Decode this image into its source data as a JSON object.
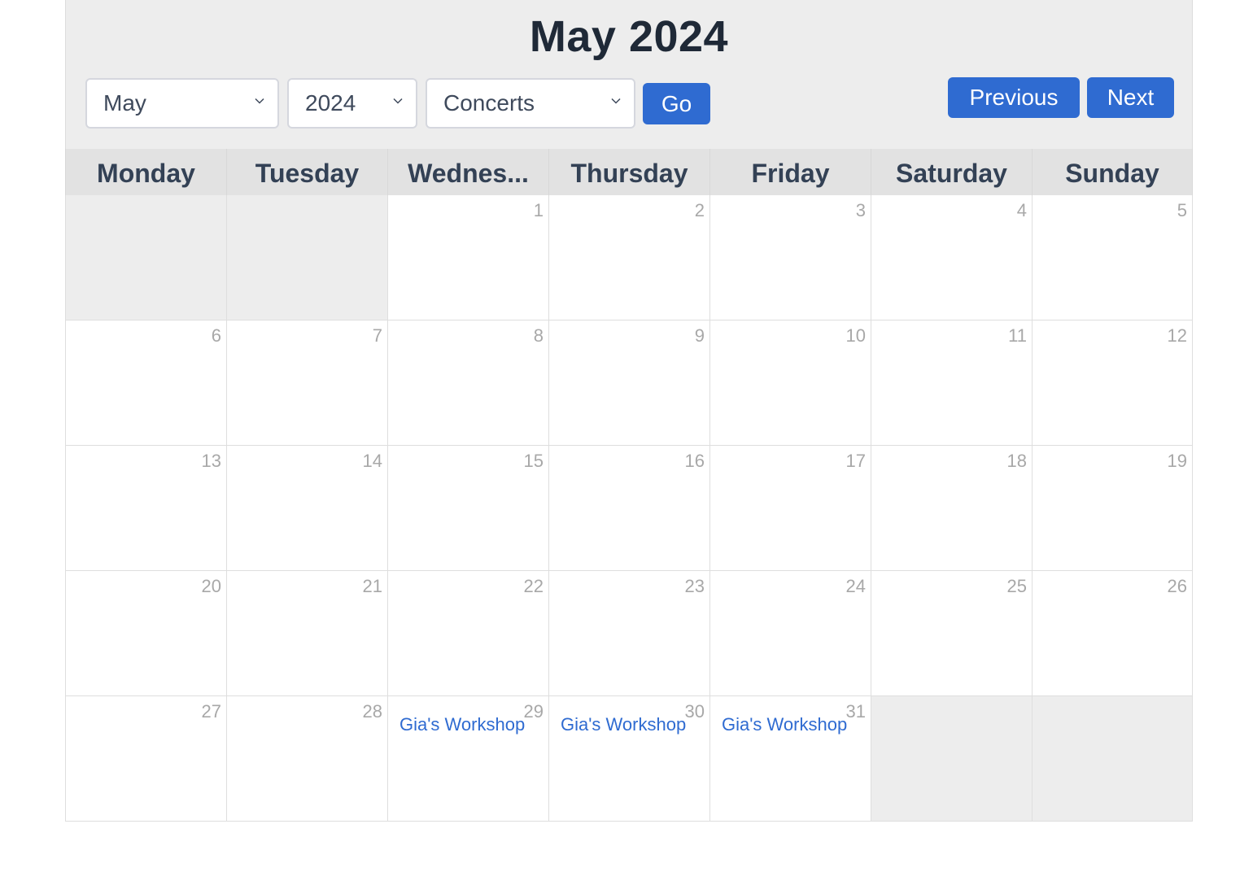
{
  "header": {
    "title": "May 2024",
    "month_select": {
      "value": "May"
    },
    "year_select": {
      "value": "2024"
    },
    "category_select": {
      "value": "Concerts"
    },
    "go_label": "Go",
    "previous_label": "Previous",
    "next_label": "Next"
  },
  "weekdays": [
    "Monday",
    "Tuesday",
    "Wednes...",
    "Thursday",
    "Friday",
    "Saturday",
    "Sunday"
  ],
  "weeks": [
    [
      {
        "day": ""
      },
      {
        "day": ""
      },
      {
        "day": "1"
      },
      {
        "day": "2"
      },
      {
        "day": "3"
      },
      {
        "day": "4"
      },
      {
        "day": "5"
      }
    ],
    [
      {
        "day": "6"
      },
      {
        "day": "7"
      },
      {
        "day": "8"
      },
      {
        "day": "9"
      },
      {
        "day": "10"
      },
      {
        "day": "11"
      },
      {
        "day": "12"
      }
    ],
    [
      {
        "day": "13"
      },
      {
        "day": "14"
      },
      {
        "day": "15"
      },
      {
        "day": "16"
      },
      {
        "day": "17"
      },
      {
        "day": "18"
      },
      {
        "day": "19"
      }
    ],
    [
      {
        "day": "20"
      },
      {
        "day": "21"
      },
      {
        "day": "22"
      },
      {
        "day": "23"
      },
      {
        "day": "24"
      },
      {
        "day": "25"
      },
      {
        "day": "26"
      }
    ],
    [
      {
        "day": "27"
      },
      {
        "day": "28"
      },
      {
        "day": "29",
        "event": "Gia's Workshop"
      },
      {
        "day": "30",
        "event": "Gia's Workshop"
      },
      {
        "day": "31",
        "event": "Gia's Workshop"
      },
      {
        "day": ""
      },
      {
        "day": ""
      }
    ]
  ],
  "colors": {
    "accent": "#2f6bd1",
    "header_bg": "#ededed",
    "weekday_bg": "#e2e2e2",
    "title_text": "#1f2937",
    "day_number": "#a8a8a8"
  }
}
